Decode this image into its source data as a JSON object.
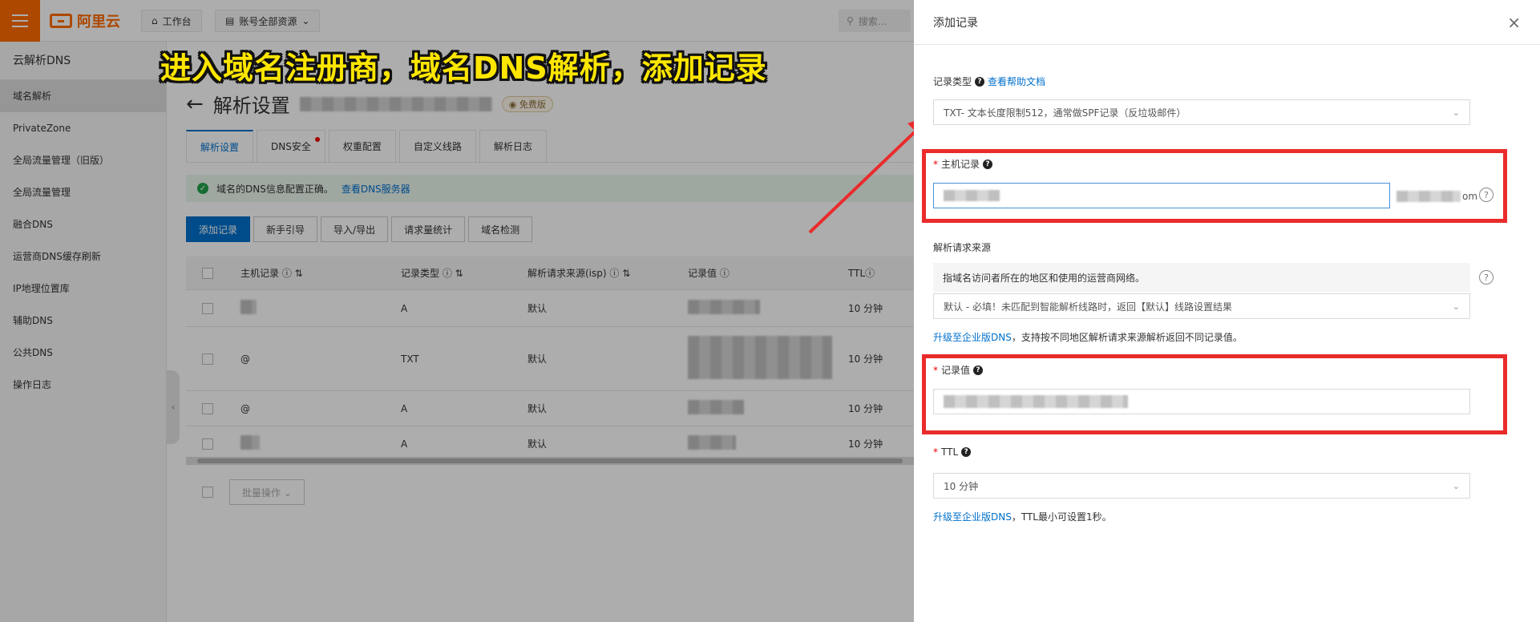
{
  "topbar": {
    "brand": "阿里云",
    "workbench": "工作台",
    "account_scope": "账号全部资源",
    "search_placeholder": "搜索..."
  },
  "sidebar": {
    "title": "云解析DNS",
    "items": [
      {
        "label": "域名解析",
        "active": true
      },
      {
        "label": "PrivateZone"
      },
      {
        "label": "全局流量管理（旧版）"
      },
      {
        "label": "全局流量管理"
      },
      {
        "label": "融合DNS"
      },
      {
        "label": "运营商DNS缓存刷新"
      },
      {
        "label": "IP地理位置库"
      },
      {
        "label": "辅助DNS"
      },
      {
        "label": "公共DNS"
      },
      {
        "label": "操作日志"
      }
    ]
  },
  "main": {
    "title": "解析设置",
    "badge": "免费版",
    "tabs": [
      "解析设置",
      "DNS安全",
      "权重配置",
      "自定义线路",
      "解析日志"
    ],
    "notice_text": "域名的DNS信息配置正确。",
    "notice_link": "查看DNS服务器",
    "toolbar": [
      "添加记录",
      "新手引导",
      "导入/导出",
      "请求量统计",
      "域名检测"
    ],
    "table": {
      "headers": [
        "主机记录",
        "记录类型",
        "解析请求来源(isp)",
        "记录值",
        "TTL"
      ],
      "rows": [
        {
          "host": "",
          "type": "A",
          "source": "默认",
          "ttl": "10 分钟"
        },
        {
          "host": "@",
          "type": "TXT",
          "source": "默认",
          "ttl": "10 分钟"
        },
        {
          "host": "@",
          "type": "A",
          "source": "默认",
          "ttl": "10 分钟"
        },
        {
          "host": "",
          "type": "A",
          "source": "默认",
          "ttl": "10 分钟"
        }
      ]
    },
    "batch_label": "批量操作"
  },
  "banner": "进入域名注册商，域名DNS解析，添加记录",
  "drawer": {
    "title": "添加记录",
    "record_type_label": "记录类型",
    "help_link": "查看帮助文档",
    "record_type_value": "TXT- 文本长度限制512，通常做SPF记录（反垃圾邮件）",
    "host_label": "主机记录",
    "host_suffix": "om",
    "source_label": "解析请求来源",
    "source_hint": "指域名访问者所在的地区和使用的运营商网络。",
    "source_value": "默认 - 必填！未匹配到智能解析线路时，返回【默认】线路设置结果",
    "upgrade_link": "升级至企业版DNS",
    "upgrade_source_text": "，支持按不同地区解析请求来源解析返回不同记录值。",
    "value_label": "记录值",
    "ttl_label": "TTL",
    "ttl_value": "10 分钟",
    "upgrade_ttl_text": "，TTL最小可设置1秒。"
  },
  "colors": {
    "brand": "#ff6a00",
    "primary": "#0070cc",
    "highlight_red": "#ea2b2b",
    "banner_yellow": "#ffe600"
  }
}
